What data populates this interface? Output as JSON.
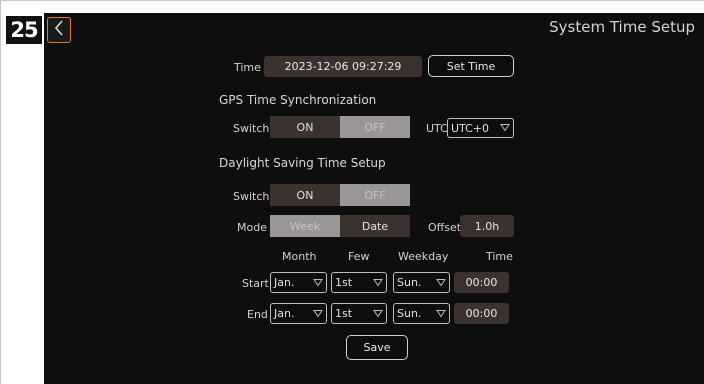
{
  "step_number": "25",
  "header": {
    "title": "System Time Setup",
    "back_icon": "chevron-left-icon"
  },
  "time_row": {
    "label": "Time",
    "value": "2023-12-06 09:27:29",
    "set_button": "Set Time"
  },
  "gps": {
    "section_title": "GPS Time Synchronization",
    "switch_label": "Switch",
    "on_label": "ON",
    "off_label": "OFF",
    "utc_label": "UTC",
    "utc_value": "UTC+0"
  },
  "dst": {
    "section_title": "Daylight Saving Time Setup",
    "switch_label": "Switch",
    "on_label": "ON",
    "off_label": "OFF",
    "mode_label": "Mode",
    "mode_week": "Week",
    "mode_date": "Date",
    "offset_label": "Offset",
    "offset_value": "1.0h",
    "columns": {
      "month": "Month",
      "few": "Few",
      "weekday": "Weekday",
      "time": "Time"
    },
    "start": {
      "label": "Start",
      "month": "Jan.",
      "few": "1st",
      "weekday": "Sun.",
      "time": "00:00"
    },
    "end": {
      "label": "End",
      "month": "Jan.",
      "few": "1st",
      "weekday": "Sun.",
      "time": "00:00"
    }
  },
  "save_label": "Save",
  "colors": {
    "accent": "#e07a1f",
    "background": "#0e0e0e",
    "dark_button": "#3b3230",
    "off_state": "#9a9597"
  }
}
